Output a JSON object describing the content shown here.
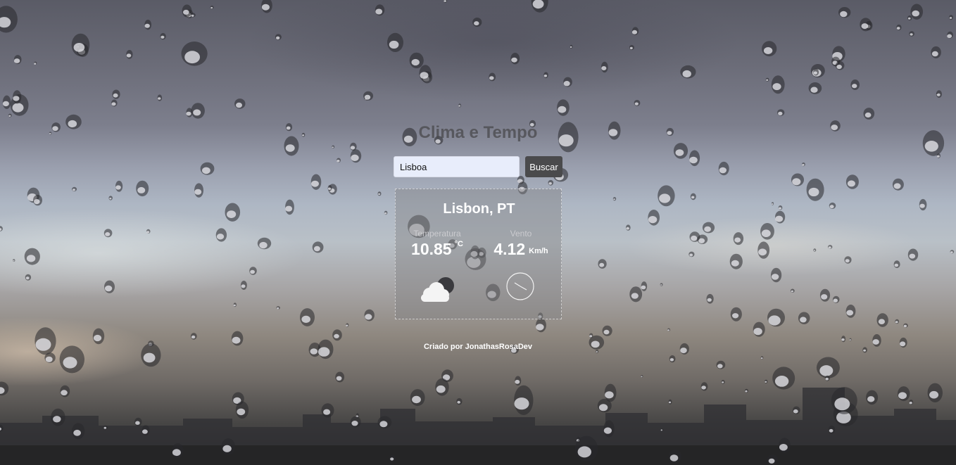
{
  "app": {
    "title": "Clima e Tempo"
  },
  "search": {
    "value": "Lisboa",
    "button_label": "Buscar"
  },
  "weather": {
    "city": "Lisbon, PT",
    "temperature_label": "Temperatura",
    "temperature_value": "10.85",
    "temperature_unit": "°C",
    "wind_label": "Vento",
    "wind_value": "4.12",
    "wind_unit": "Km/h",
    "condition_icon": "cloud-night-icon",
    "wind_icon": "wind-direction-icon"
  },
  "footer": {
    "credit": "Criado por JonathasRosaDev"
  },
  "colors": {
    "button_bg": "#4a4a4c",
    "input_bg": "#e8edfb",
    "card_bg": "rgba(128,128,130,0.42)"
  }
}
